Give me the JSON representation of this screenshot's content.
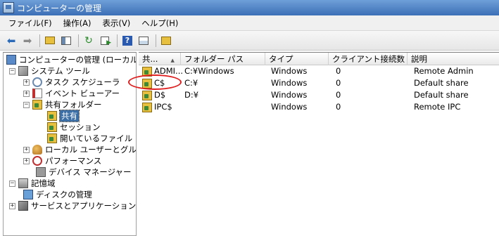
{
  "window": {
    "title": "コンピューターの管理"
  },
  "menu": [
    {
      "label": "ファイル(F)"
    },
    {
      "label": "操作(A)"
    },
    {
      "label": "表示(V)"
    },
    {
      "label": "ヘルプ(H)"
    }
  ],
  "toolbar": {
    "icons": [
      "back-arrow-icon",
      "forward-arrow-icon",
      "up-folder-icon",
      "show-tree-icon",
      "refresh-icon",
      "export-icon",
      "help-icon",
      "properties-icon",
      "new-share-icon"
    ]
  },
  "tree": {
    "items": [
      {
        "label": "コンピューターの管理 (ローカル)",
        "expander": ""
      },
      {
        "label": "システム ツール",
        "expander": "−"
      },
      {
        "label": "タスク スケジューラ",
        "expander": "+"
      },
      {
        "label": "イベント ビューアー",
        "expander": "+"
      },
      {
        "label": "共有フォルダー",
        "expander": "−"
      },
      {
        "label": "共有",
        "expander": ""
      },
      {
        "label": "セッション",
        "expander": ""
      },
      {
        "label": "開いているファイル",
        "expander": ""
      },
      {
        "label": "ローカル ユーザーとグループ",
        "expander": "+"
      },
      {
        "label": "パフォーマンス",
        "expander": "+"
      },
      {
        "label": "デバイス マネージャー",
        "expander": ""
      },
      {
        "label": "記憶域",
        "expander": "−"
      },
      {
        "label": "ディスクの管理",
        "expander": ""
      },
      {
        "label": "サービスとアプリケーション",
        "expander": "+"
      }
    ]
  },
  "list": {
    "columns": [
      {
        "label": "共..."
      },
      {
        "label": "フォルダー パス"
      },
      {
        "label": "タイプ"
      },
      {
        "label": "クライアント接続数"
      },
      {
        "label": "説明"
      }
    ],
    "rows": [
      {
        "name": "ADMI...",
        "path": "C:¥Windows",
        "type": "Windows",
        "clients": "0",
        "desc": "Remote Admin"
      },
      {
        "name": "C$",
        "path": "C:¥",
        "type": "Windows",
        "clients": "0",
        "desc": "Default share"
      },
      {
        "name": "D$",
        "path": "D:¥",
        "type": "Windows",
        "clients": "0",
        "desc": "Default share"
      },
      {
        "name": "IPC$",
        "path": "",
        "type": "Windows",
        "clients": "0",
        "desc": "Remote IPC"
      }
    ]
  },
  "colors": {
    "selection": "#3a6ea5",
    "annotation": "#e02020"
  }
}
